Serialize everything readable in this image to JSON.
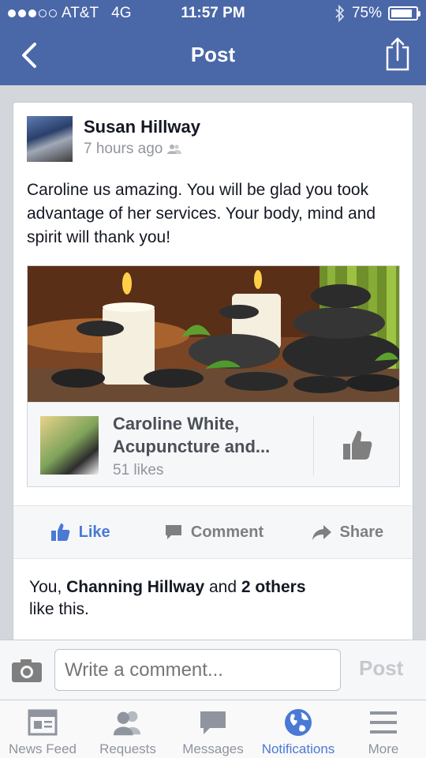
{
  "status_bar": {
    "carrier": "AT&T",
    "network": "4G",
    "time": "11:57 PM",
    "battery": "75%"
  },
  "nav": {
    "title": "Post"
  },
  "post": {
    "author": "Susan Hillway",
    "timestamp": "7 hours ago",
    "text": "Caroline us amazing. You will be glad you took advantage of her services.  Your body, mind and spirit will thank you!",
    "attachment": {
      "page_name": "Caroline White, Acupuncture and...",
      "page_likes": "51 likes"
    },
    "actions": {
      "like": "Like",
      "comment": "Comment",
      "share": "Share"
    },
    "likes_summary": {
      "prefix": "You, ",
      "person": "Channing Hillway",
      "middle": " and ",
      "others": "2 others",
      "suffix": "like this."
    }
  },
  "comment_bar": {
    "placeholder": "Write a comment...",
    "post_label": "Post"
  },
  "tabbar": {
    "tabs": [
      {
        "label": "News Feed",
        "icon": "news-feed-icon"
      },
      {
        "label": "Requests",
        "icon": "friend-requests-icon"
      },
      {
        "label": "Messages",
        "icon": "messages-icon"
      },
      {
        "label": "Notifications",
        "icon": "globe-icon",
        "active": true
      },
      {
        "label": "More",
        "icon": "menu-icon"
      }
    ]
  },
  "colors": {
    "facebook_blue": "#4a67a8",
    "active_blue": "#4a79d6"
  }
}
